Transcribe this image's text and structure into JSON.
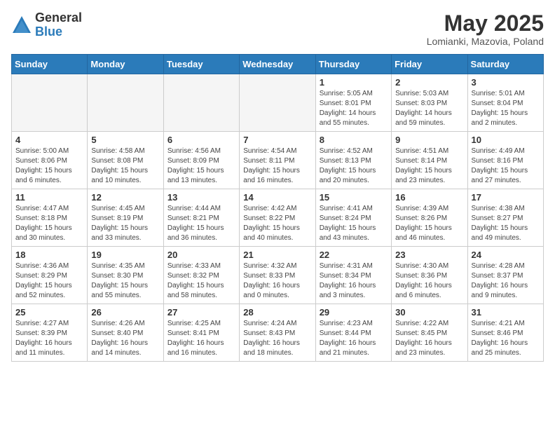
{
  "logo": {
    "general": "General",
    "blue": "Blue"
  },
  "title": "May 2025",
  "subtitle": "Lomianki, Mazovia, Poland",
  "days_header": [
    "Sunday",
    "Monday",
    "Tuesday",
    "Wednesday",
    "Thursday",
    "Friday",
    "Saturday"
  ],
  "weeks": [
    [
      {
        "day": "",
        "info": ""
      },
      {
        "day": "",
        "info": ""
      },
      {
        "day": "",
        "info": ""
      },
      {
        "day": "",
        "info": ""
      },
      {
        "day": "1",
        "info": "Sunrise: 5:05 AM\nSunset: 8:01 PM\nDaylight: 14 hours\nand 55 minutes."
      },
      {
        "day": "2",
        "info": "Sunrise: 5:03 AM\nSunset: 8:03 PM\nDaylight: 14 hours\nand 59 minutes."
      },
      {
        "day": "3",
        "info": "Sunrise: 5:01 AM\nSunset: 8:04 PM\nDaylight: 15 hours\nand 2 minutes."
      }
    ],
    [
      {
        "day": "4",
        "info": "Sunrise: 5:00 AM\nSunset: 8:06 PM\nDaylight: 15 hours\nand 6 minutes."
      },
      {
        "day": "5",
        "info": "Sunrise: 4:58 AM\nSunset: 8:08 PM\nDaylight: 15 hours\nand 10 minutes."
      },
      {
        "day": "6",
        "info": "Sunrise: 4:56 AM\nSunset: 8:09 PM\nDaylight: 15 hours\nand 13 minutes."
      },
      {
        "day": "7",
        "info": "Sunrise: 4:54 AM\nSunset: 8:11 PM\nDaylight: 15 hours\nand 16 minutes."
      },
      {
        "day": "8",
        "info": "Sunrise: 4:52 AM\nSunset: 8:13 PM\nDaylight: 15 hours\nand 20 minutes."
      },
      {
        "day": "9",
        "info": "Sunrise: 4:51 AM\nSunset: 8:14 PM\nDaylight: 15 hours\nand 23 minutes."
      },
      {
        "day": "10",
        "info": "Sunrise: 4:49 AM\nSunset: 8:16 PM\nDaylight: 15 hours\nand 27 minutes."
      }
    ],
    [
      {
        "day": "11",
        "info": "Sunrise: 4:47 AM\nSunset: 8:18 PM\nDaylight: 15 hours\nand 30 minutes."
      },
      {
        "day": "12",
        "info": "Sunrise: 4:45 AM\nSunset: 8:19 PM\nDaylight: 15 hours\nand 33 minutes."
      },
      {
        "day": "13",
        "info": "Sunrise: 4:44 AM\nSunset: 8:21 PM\nDaylight: 15 hours\nand 36 minutes."
      },
      {
        "day": "14",
        "info": "Sunrise: 4:42 AM\nSunset: 8:22 PM\nDaylight: 15 hours\nand 40 minutes."
      },
      {
        "day": "15",
        "info": "Sunrise: 4:41 AM\nSunset: 8:24 PM\nDaylight: 15 hours\nand 43 minutes."
      },
      {
        "day": "16",
        "info": "Sunrise: 4:39 AM\nSunset: 8:26 PM\nDaylight: 15 hours\nand 46 minutes."
      },
      {
        "day": "17",
        "info": "Sunrise: 4:38 AM\nSunset: 8:27 PM\nDaylight: 15 hours\nand 49 minutes."
      }
    ],
    [
      {
        "day": "18",
        "info": "Sunrise: 4:36 AM\nSunset: 8:29 PM\nDaylight: 15 hours\nand 52 minutes."
      },
      {
        "day": "19",
        "info": "Sunrise: 4:35 AM\nSunset: 8:30 PM\nDaylight: 15 hours\nand 55 minutes."
      },
      {
        "day": "20",
        "info": "Sunrise: 4:33 AM\nSunset: 8:32 PM\nDaylight: 15 hours\nand 58 minutes."
      },
      {
        "day": "21",
        "info": "Sunrise: 4:32 AM\nSunset: 8:33 PM\nDaylight: 16 hours\nand 0 minutes."
      },
      {
        "day": "22",
        "info": "Sunrise: 4:31 AM\nSunset: 8:34 PM\nDaylight: 16 hours\nand 3 minutes."
      },
      {
        "day": "23",
        "info": "Sunrise: 4:30 AM\nSunset: 8:36 PM\nDaylight: 16 hours\nand 6 minutes."
      },
      {
        "day": "24",
        "info": "Sunrise: 4:28 AM\nSunset: 8:37 PM\nDaylight: 16 hours\nand 9 minutes."
      }
    ],
    [
      {
        "day": "25",
        "info": "Sunrise: 4:27 AM\nSunset: 8:39 PM\nDaylight: 16 hours\nand 11 minutes."
      },
      {
        "day": "26",
        "info": "Sunrise: 4:26 AM\nSunset: 8:40 PM\nDaylight: 16 hours\nand 14 minutes."
      },
      {
        "day": "27",
        "info": "Sunrise: 4:25 AM\nSunset: 8:41 PM\nDaylight: 16 hours\nand 16 minutes."
      },
      {
        "day": "28",
        "info": "Sunrise: 4:24 AM\nSunset: 8:43 PM\nDaylight: 16 hours\nand 18 minutes."
      },
      {
        "day": "29",
        "info": "Sunrise: 4:23 AM\nSunset: 8:44 PM\nDaylight: 16 hours\nand 21 minutes."
      },
      {
        "day": "30",
        "info": "Sunrise: 4:22 AM\nSunset: 8:45 PM\nDaylight: 16 hours\nand 23 minutes."
      },
      {
        "day": "31",
        "info": "Sunrise: 4:21 AM\nSunset: 8:46 PM\nDaylight: 16 hours\nand 25 minutes."
      }
    ]
  ]
}
